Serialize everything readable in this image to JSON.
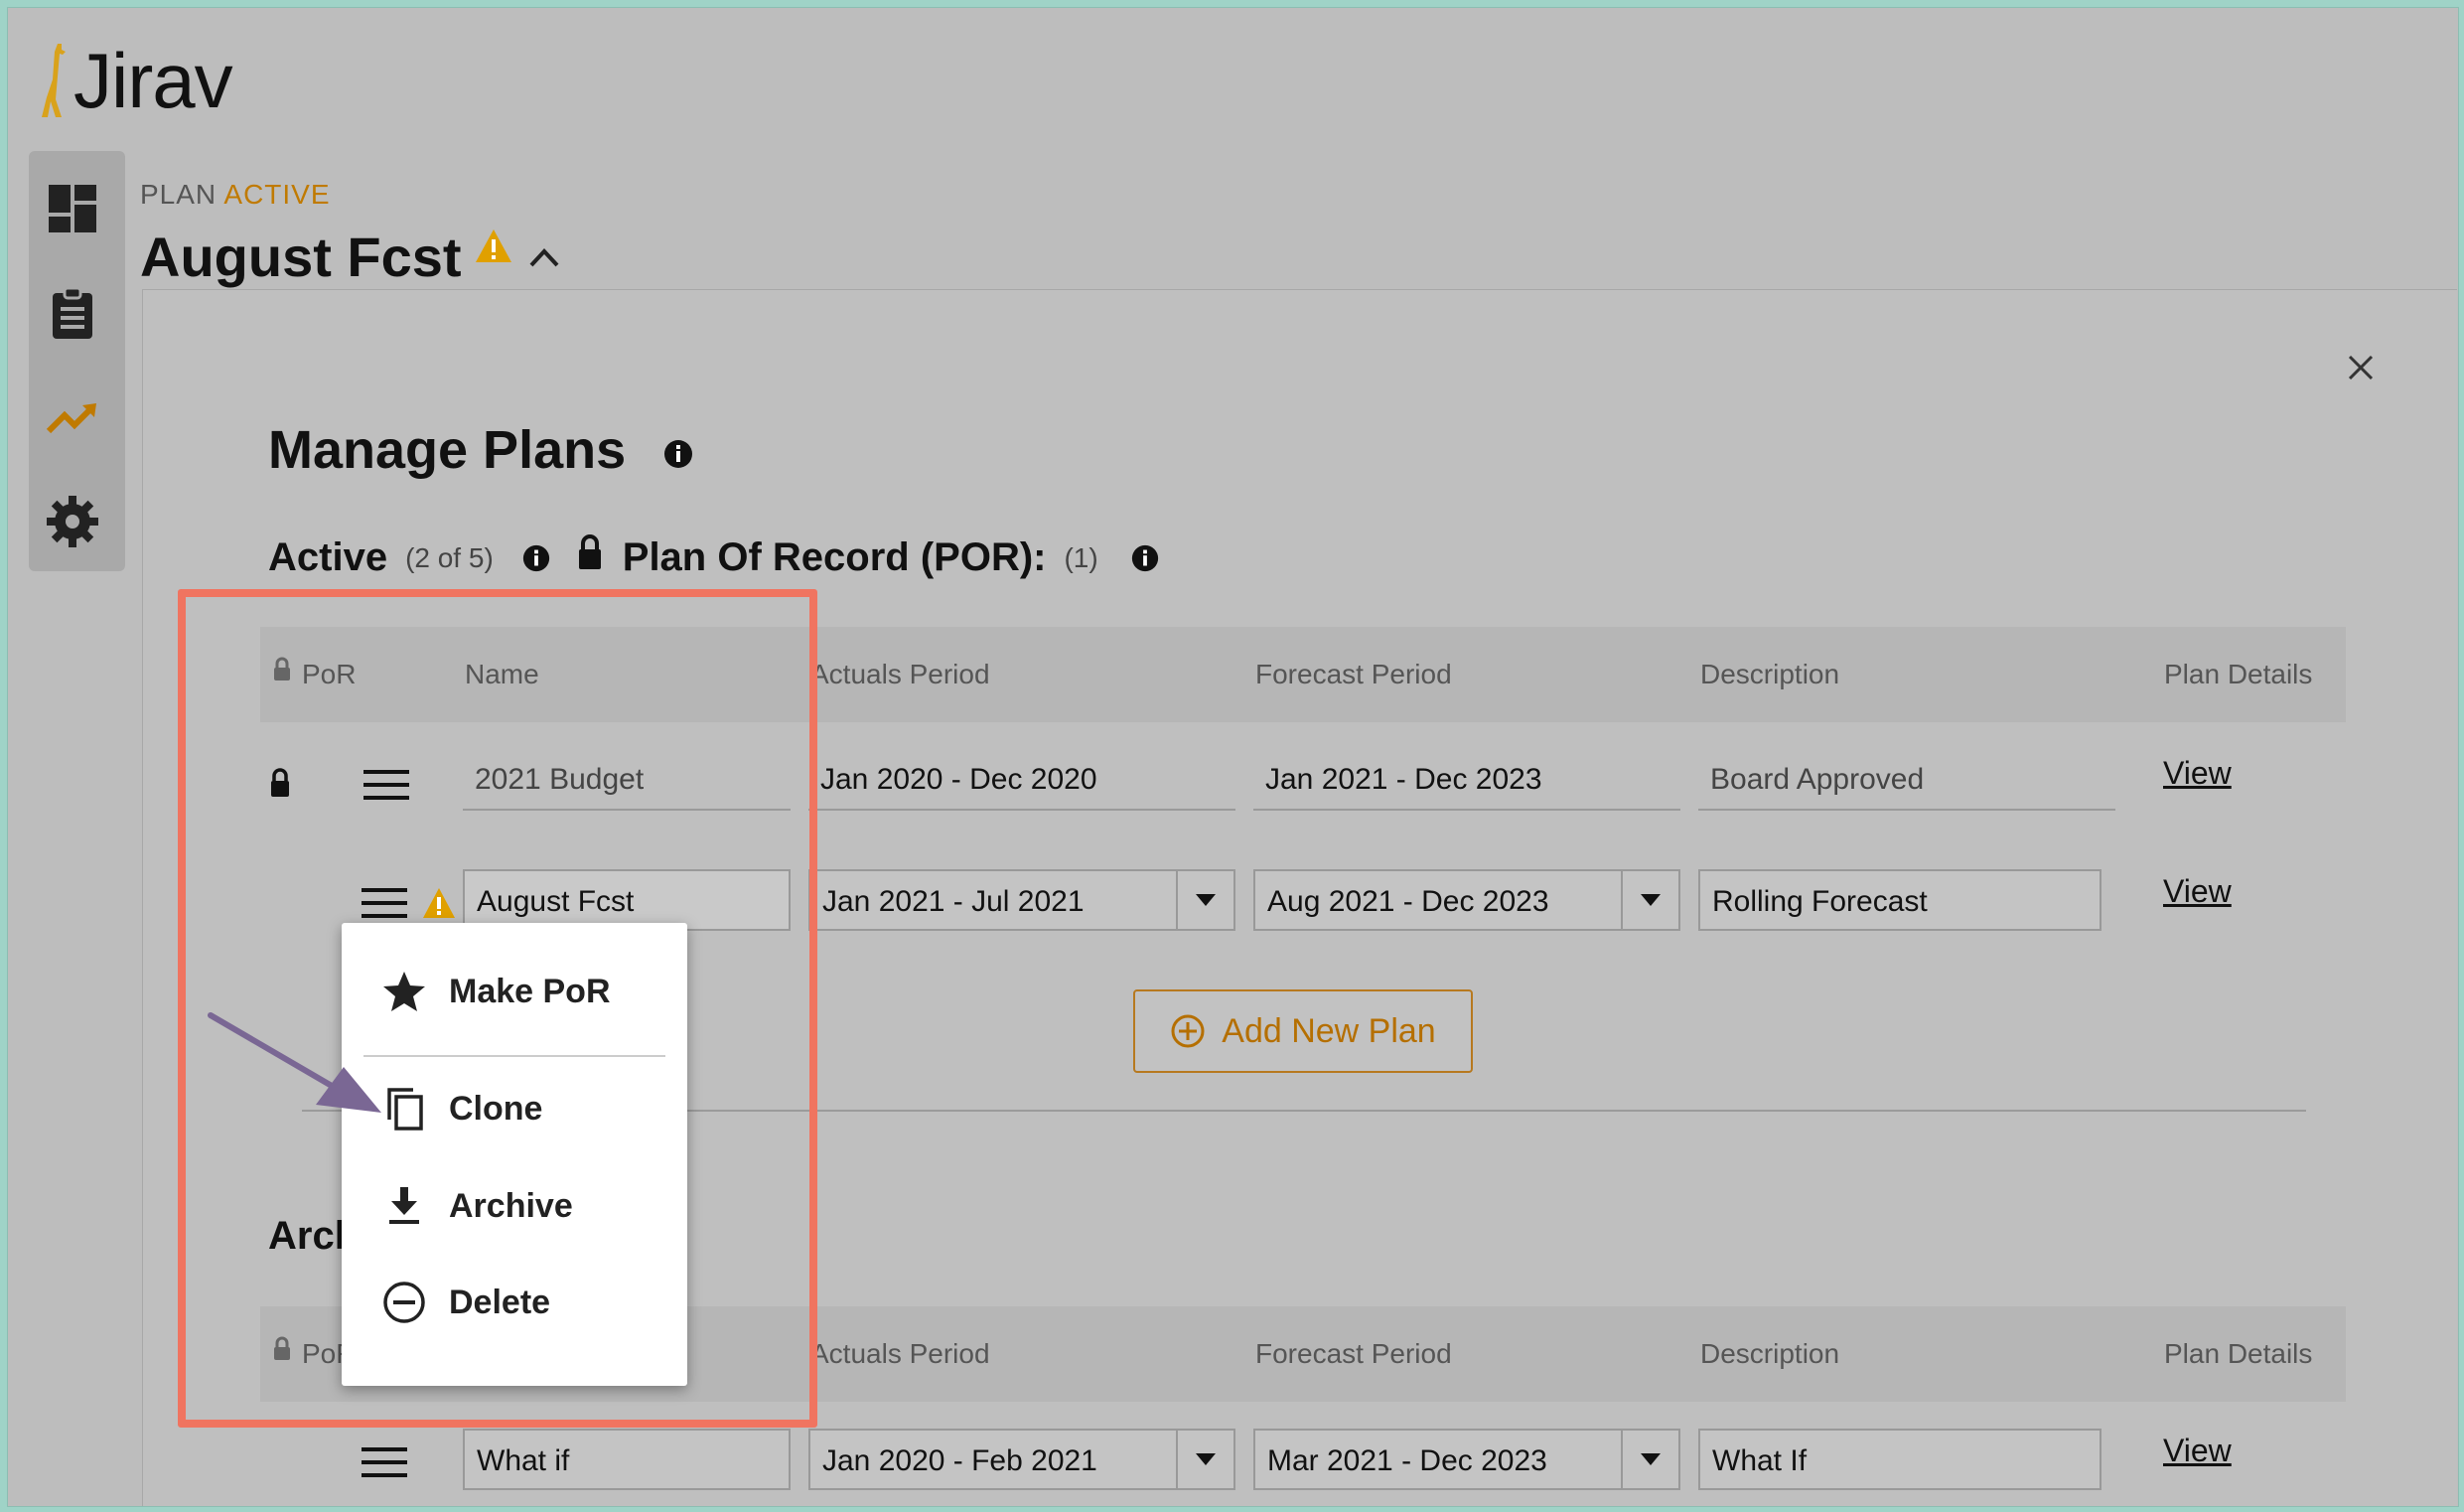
{
  "app": {
    "brand": "Jirav"
  },
  "plan": {
    "status_prefix": "PLAN",
    "status": "ACTIVE",
    "title": "August Fcst"
  },
  "modal": {
    "title": "Manage Plans",
    "active": {
      "heading": "Active",
      "count": "(2 of 5)"
    },
    "por": {
      "heading": "Plan Of Record (POR):",
      "count": "(1)"
    },
    "archived": {
      "heading_partial": "Arcl"
    },
    "columns": [
      "PoR",
      "Name",
      "Actuals Period",
      "Forecast Period",
      "Description",
      "Plan Details"
    ],
    "active_rows": [
      {
        "name": "2021 Budget",
        "actuals": "Jan 2020 - Dec 2020",
        "forecast": "Jan 2021 - Dec 2023",
        "description": "Board Approved",
        "details": "View"
      },
      {
        "name": "August Fcst",
        "actuals": "Jan 2021 - Jul 2021",
        "forecast": "Aug 2021 - Dec 2023",
        "description": "Rolling Forecast",
        "details": "View"
      }
    ],
    "add_plan": "Add New Plan",
    "archived_rows": [
      {
        "name": "What if",
        "actuals": "Jan 2020 - Feb 2021",
        "forecast": "Mar 2021 - Dec 2023",
        "description": "What If",
        "details": "View"
      }
    ]
  },
  "context_menu": {
    "items": [
      {
        "label": "Make PoR",
        "icon": "star-icon"
      },
      {
        "label": "Clone",
        "icon": "copy-icon"
      },
      {
        "label": "Archive",
        "icon": "download-icon"
      },
      {
        "label": "Delete",
        "icon": "minus-circle-icon"
      }
    ]
  },
  "colors": {
    "accent": "#c07a00",
    "highlight": "#f07460",
    "arrow": "#7a6794",
    "warning": "#e0a000"
  }
}
